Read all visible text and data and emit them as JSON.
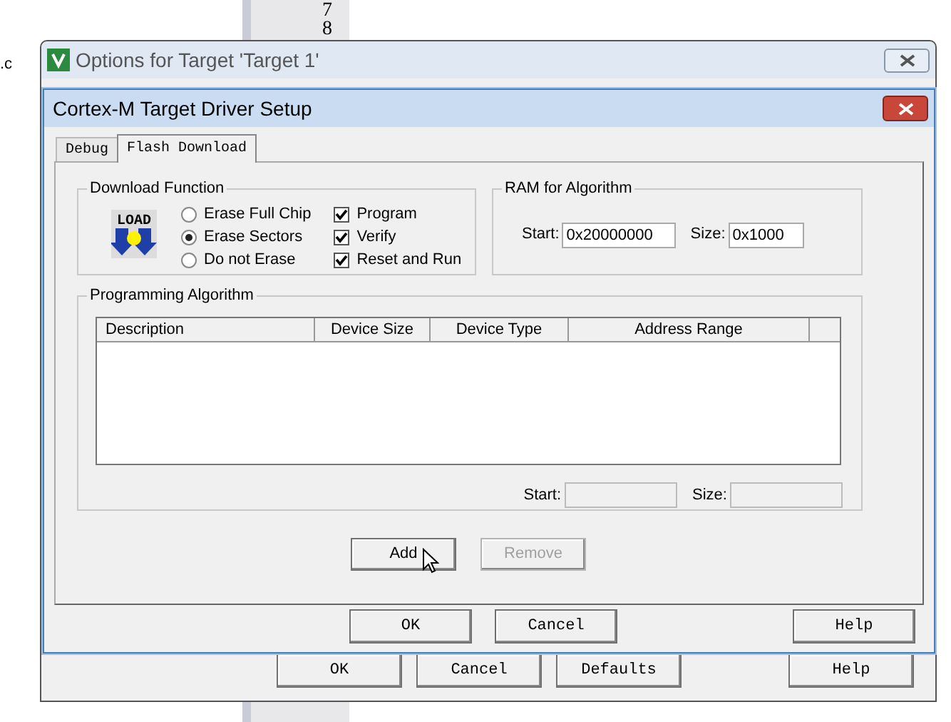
{
  "background": {
    "file_suffix": ".c",
    "line_numbers": [
      "7",
      "8"
    ]
  },
  "outer_window": {
    "title": "Options for Target 'Target 1'",
    "buttons": [
      {
        "label": "OK",
        "disabled": false
      },
      {
        "label": "Cancel",
        "disabled": false
      },
      {
        "label": "Defaults",
        "disabled": false
      },
      {
        "label": "Help",
        "disabled": false
      }
    ]
  },
  "dialog": {
    "title": "Cortex-M Target Driver Setup",
    "tabs": [
      {
        "label": "Debug",
        "selected": false
      },
      {
        "label": "Flash Download",
        "selected": true
      }
    ],
    "download_function": {
      "title": "Download Function",
      "icon_text": "LOAD",
      "options": [
        {
          "label": "Erase Full Chip",
          "selected": false
        },
        {
          "label": "Erase Sectors",
          "selected": true
        },
        {
          "label": "Do not Erase",
          "selected": false
        }
      ],
      "checks": [
        {
          "label": "Program",
          "checked": true
        },
        {
          "label": "Verify",
          "checked": true
        },
        {
          "label": "Reset and Run",
          "checked": true
        }
      ]
    },
    "ram": {
      "title": "RAM for Algorithm",
      "start_label": "Start:",
      "start_value": "0x20000000",
      "size_label": "Size:",
      "size_value": "0x1000"
    },
    "algorithm": {
      "title": "Programming Algorithm",
      "columns": [
        "Description",
        "Device Size",
        "Device Type",
        "Address Range"
      ],
      "start_label": "Start:",
      "size_label": "Size:"
    },
    "actions": [
      {
        "label": "Add",
        "disabled": false
      },
      {
        "label": "Remove",
        "disabled": true
      }
    ],
    "buttons": [
      {
        "label": "OK",
        "disabled": false
      },
      {
        "label": "Cancel",
        "disabled": false
      },
      {
        "label": "Help",
        "disabled": false
      }
    ]
  }
}
